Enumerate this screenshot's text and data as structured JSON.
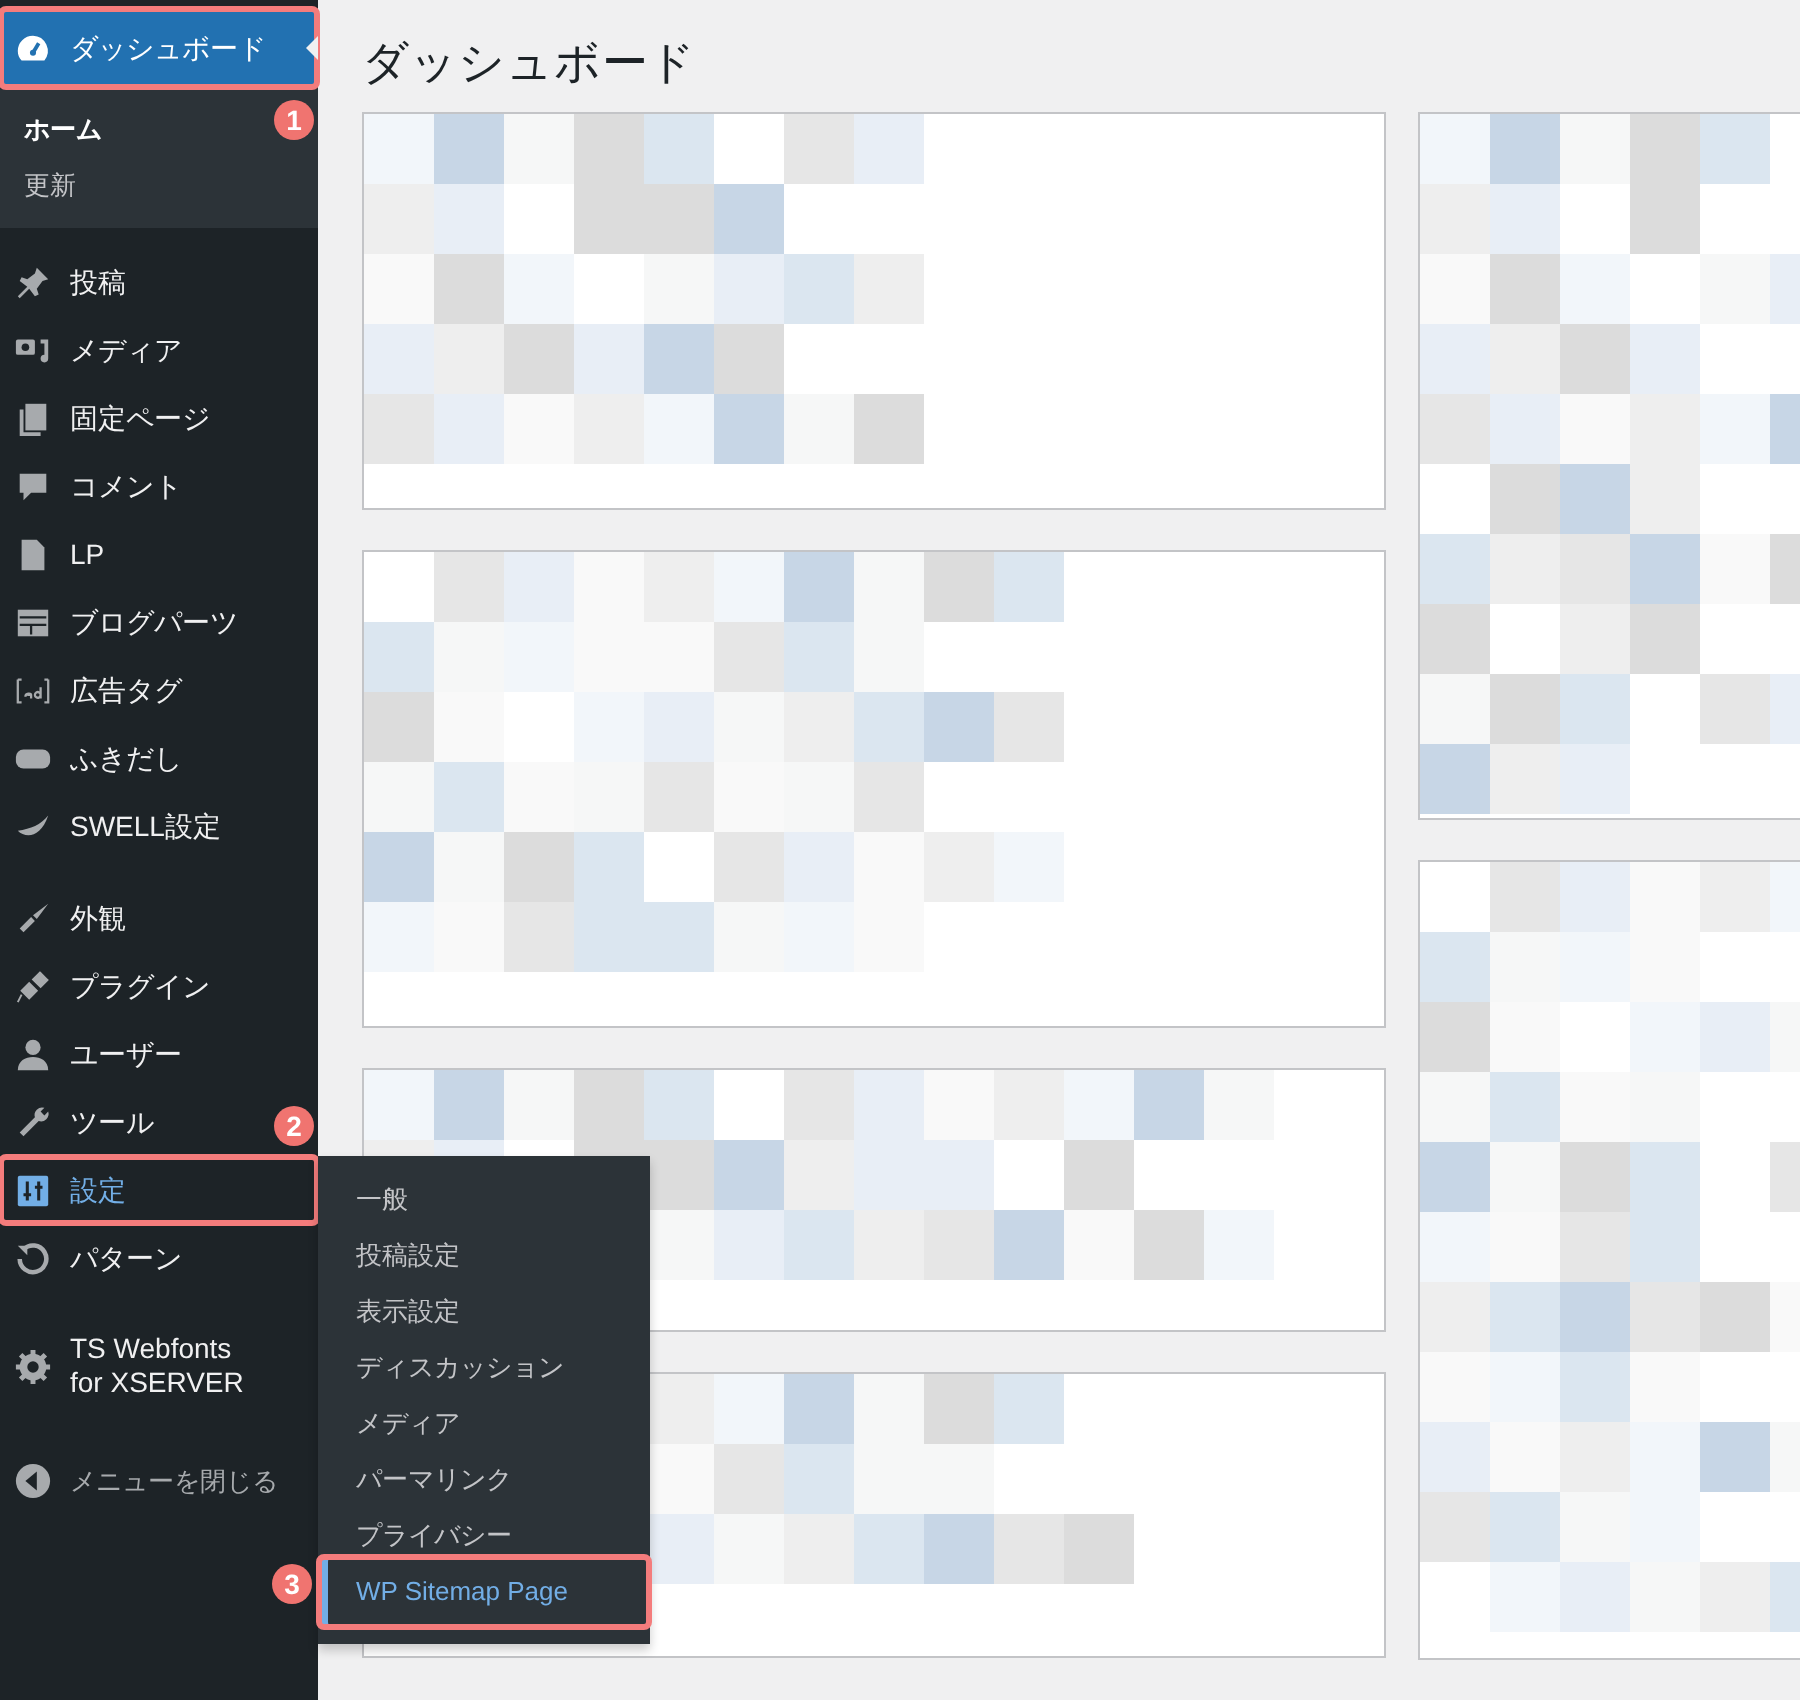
{
  "sidebar": {
    "groups": [
      {
        "items": [
          {
            "label": "ダッシュボード",
            "selected": true,
            "open": false,
            "highlighted": true,
            "marker": "1",
            "submenu": [
              {
                "label": "ホーム",
                "selected": true
              },
              {
                "label": "更新",
                "selected": false
              }
            ]
          }
        ]
      },
      {
        "items": [
          {
            "label": "投稿",
            "selected": false,
            "open": false,
            "highlighted": false
          },
          {
            "label": "メディア",
            "selected": false,
            "open": false,
            "highlighted": false
          },
          {
            "label": "固定ページ",
            "selected": false,
            "open": false,
            "highlighted": false
          },
          {
            "label": "コメント",
            "selected": false,
            "open": false,
            "highlighted": false
          },
          {
            "label": "LP",
            "selected": false,
            "open": false,
            "highlighted": false
          },
          {
            "label": "ブログパーツ",
            "selected": false,
            "open": false,
            "highlighted": false
          },
          {
            "label": "広告タグ",
            "selected": false,
            "open": false,
            "highlighted": false
          },
          {
            "label": "ふきだし",
            "selected": false,
            "open": false,
            "highlighted": false
          },
          {
            "label": "SWELL設定",
            "selected": false,
            "open": false,
            "highlighted": false
          }
        ]
      },
      {
        "items": [
          {
            "label": "外観",
            "selected": false,
            "open": false,
            "highlighted": false
          },
          {
            "label": "プラグイン",
            "selected": false,
            "open": false,
            "highlighted": false
          },
          {
            "label": "ユーザー",
            "selected": false,
            "open": false,
            "highlighted": false
          },
          {
            "label": "ツール",
            "selected": false,
            "open": false,
            "highlighted": false
          },
          {
            "label": "設定",
            "selected": false,
            "open": true,
            "highlighted": true,
            "marker": "2",
            "flyout": [
              {
                "label": "一般",
                "selected": false,
                "highlighted": false
              },
              {
                "label": "投稿設定",
                "selected": false,
                "highlighted": false
              },
              {
                "label": "表示設定",
                "selected": false,
                "highlighted": false
              },
              {
                "label": "ディスカッション",
                "selected": false,
                "highlighted": false
              },
              {
                "label": "メディア",
                "selected": false,
                "highlighted": false
              },
              {
                "label": "パーマリンク",
                "selected": false,
                "highlighted": false
              },
              {
                "label": "プライバシー",
                "selected": false,
                "highlighted": false
              },
              {
                "label": "WP Sitemap Page",
                "selected": true,
                "highlighted": true,
                "marker": "3"
              }
            ]
          },
          {
            "label": "パターン",
            "selected": false,
            "open": false,
            "highlighted": false
          }
        ]
      },
      {
        "items": [
          {
            "label": "TS Webfonts for XSERVER",
            "selected": false,
            "open": false,
            "highlighted": false
          }
        ]
      }
    ],
    "collapse_label": "メニューを閉じる"
  },
  "page_title": "ダッシュボード"
}
